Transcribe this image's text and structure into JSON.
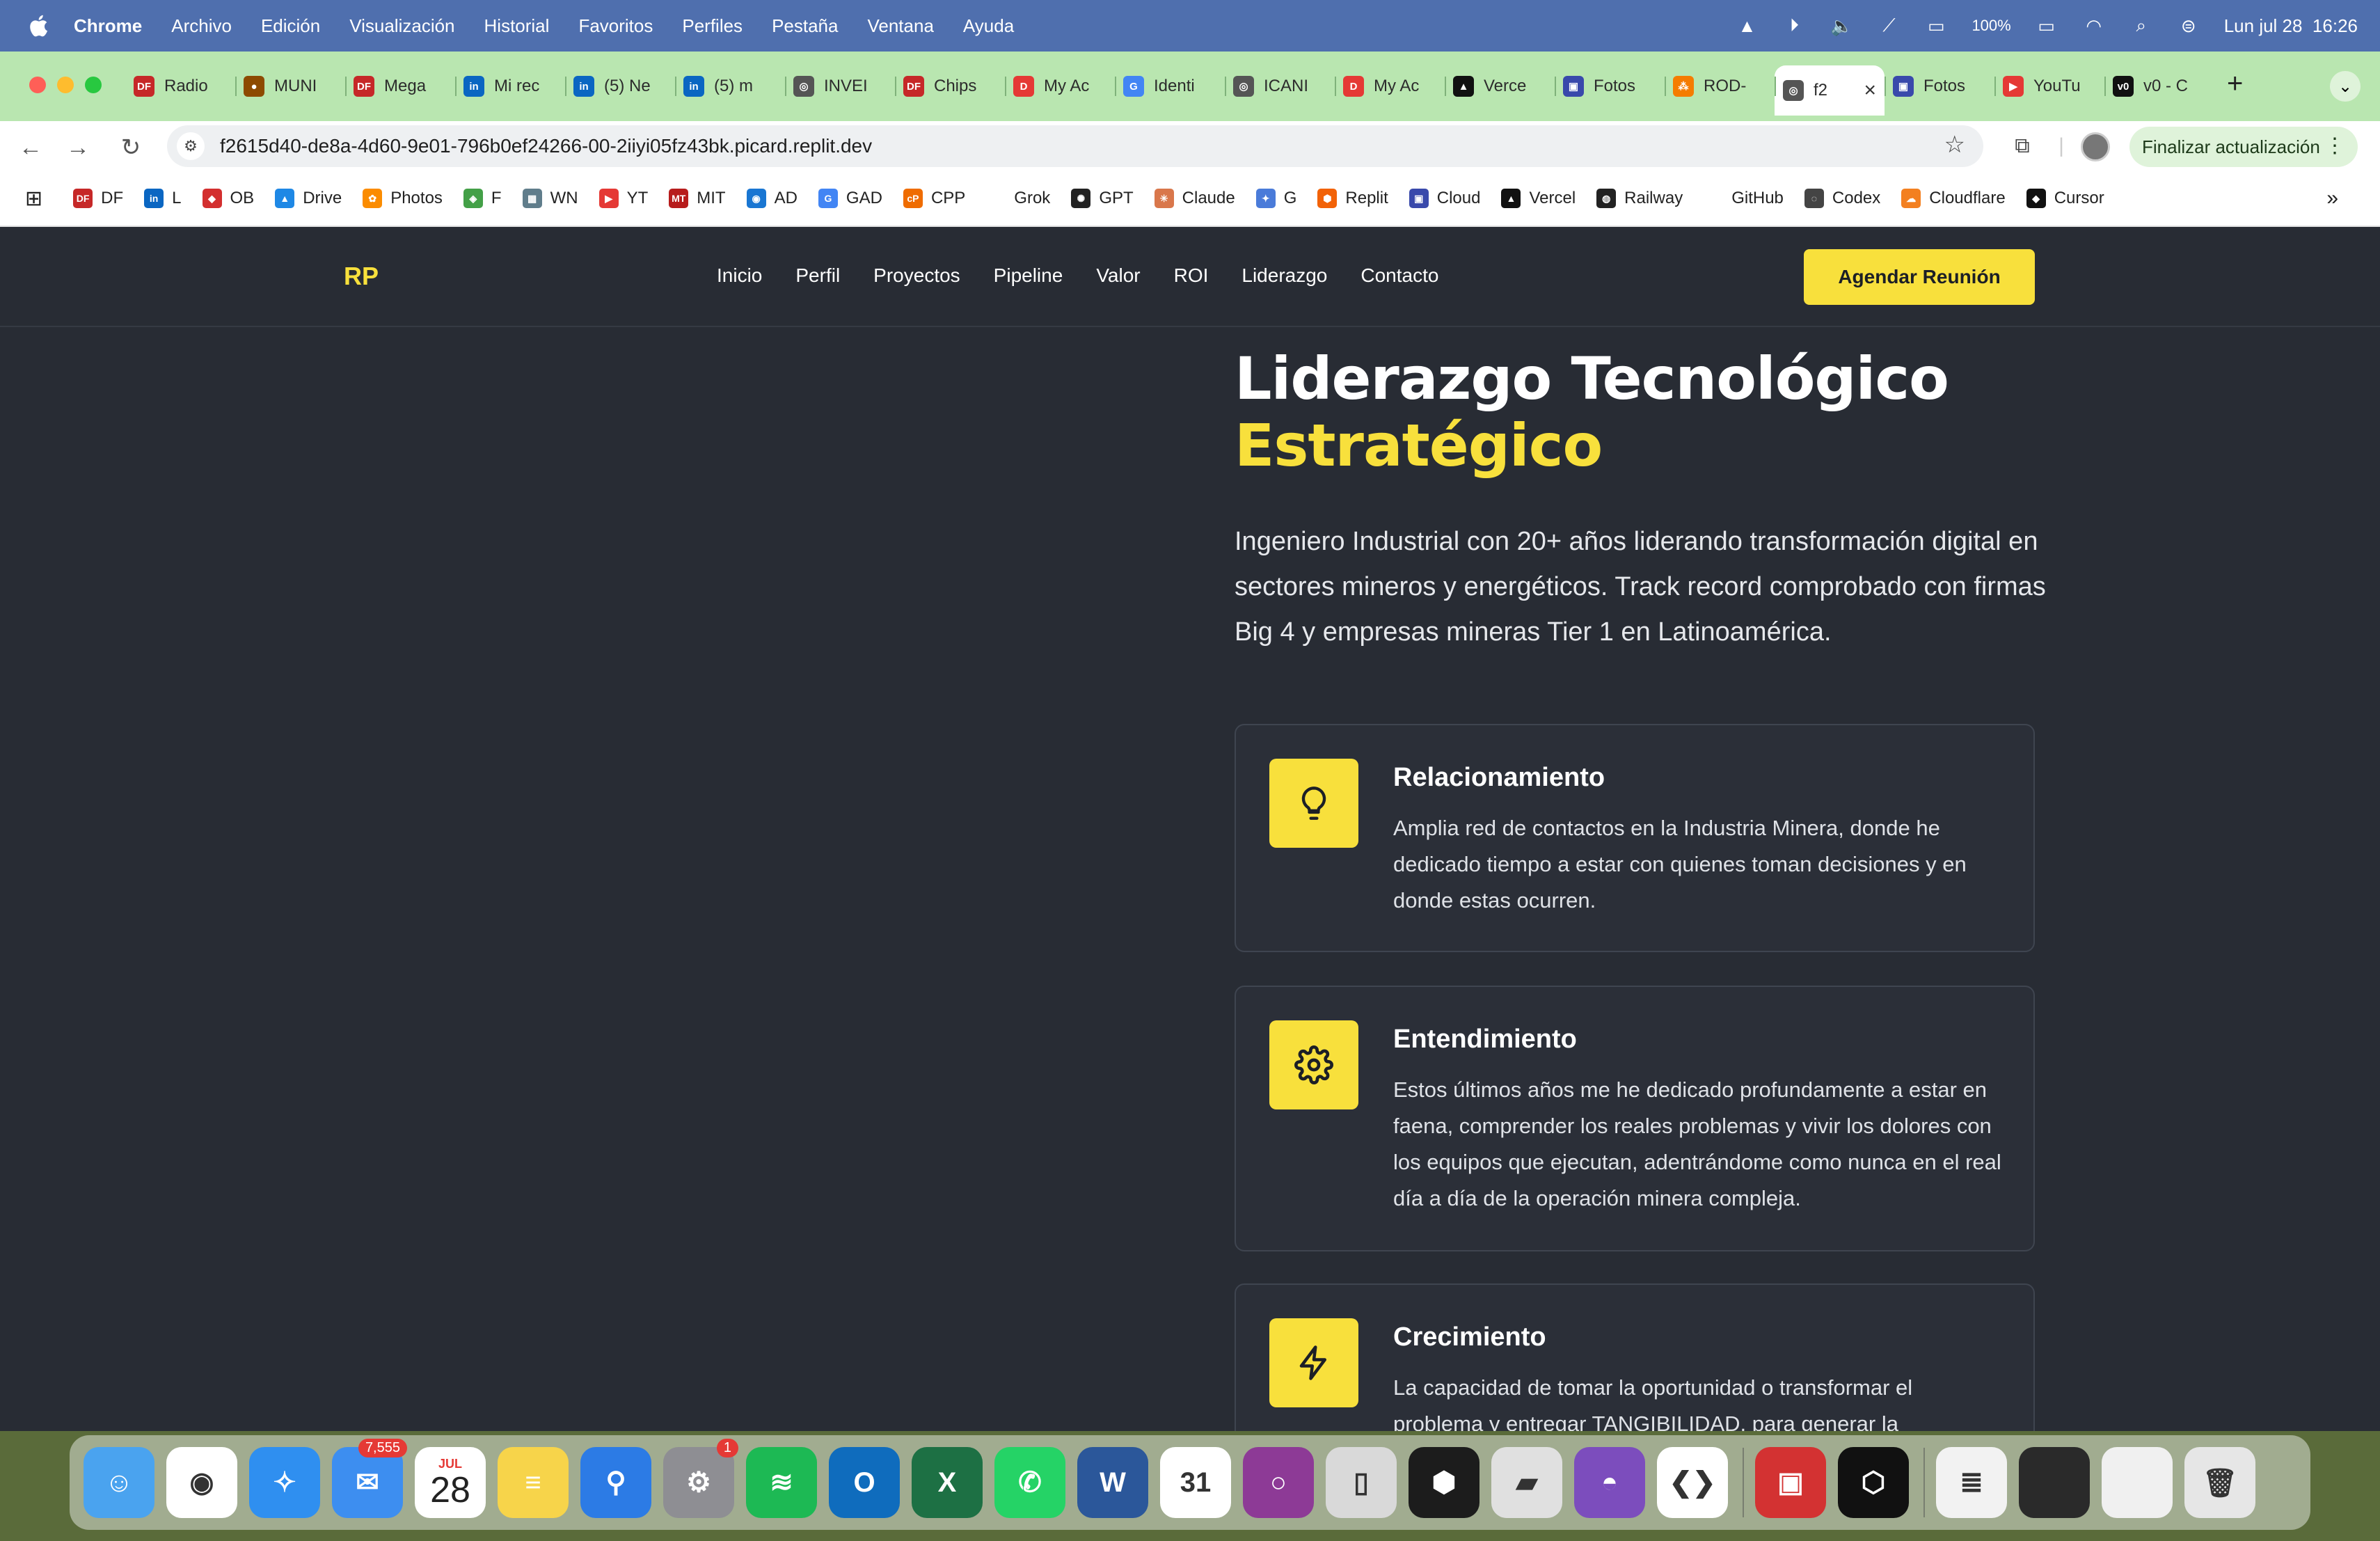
{
  "menubar": {
    "app": "Chrome",
    "items": [
      "Archivo",
      "Edición",
      "Visualización",
      "Historial",
      "Favoritos",
      "Perfiles",
      "Pestaña",
      "Ventana",
      "Ayuda"
    ],
    "battery": "100%",
    "datetime": "Lun jul 28  16:26"
  },
  "tabs": [
    {
      "label": "Radio",
      "icon": "DF",
      "color": "#c62828"
    },
    {
      "label": "MUNI",
      "icon": "●",
      "color": "#8d4a00"
    },
    {
      "label": "Mega",
      "icon": "DF",
      "color": "#c62828"
    },
    {
      "label": "Mi rec",
      "icon": "in",
      "color": "#0a66c2"
    },
    {
      "label": "(5) Ne",
      "icon": "in",
      "color": "#0a66c2"
    },
    {
      "label": "(5) m",
      "icon": "in",
      "color": "#0a66c2"
    },
    {
      "label": "INVEI",
      "icon": "◎",
      "color": "#555"
    },
    {
      "label": "Chips",
      "icon": "DF",
      "color": "#c62828"
    },
    {
      "label": "My Ac",
      "icon": "D",
      "color": "#e53935"
    },
    {
      "label": "Identi",
      "icon": "G",
      "color": "#4285f4"
    },
    {
      "label": "ICANI",
      "icon": "◎",
      "color": "#555"
    },
    {
      "label": "My Ac",
      "icon": "D",
      "color": "#e53935"
    },
    {
      "label": "Verce",
      "icon": "▲",
      "color": "#111"
    },
    {
      "label": "Fotos",
      "icon": "▣",
      "color": "#3949ab"
    },
    {
      "label": "ROD-",
      "icon": "⁂",
      "color": "#f57c00"
    },
    {
      "label": "f2",
      "icon": "◎",
      "color": "#555",
      "active": true
    },
    {
      "label": "Fotos",
      "icon": "▣",
      "color": "#3949ab"
    },
    {
      "label": "YouTu",
      "icon": "▶",
      "color": "#e53935"
    },
    {
      "label": "v0 - C",
      "icon": "v0",
      "color": "#111"
    }
  ],
  "toolbar": {
    "url": "f2615d40-de8a-4d60-9e01-796b0ef24266-00-2iiyi05fz43bk.picard.replit.dev",
    "update_label": "Finalizar actualización"
  },
  "bookmarks": [
    {
      "label": "DF",
      "icon": "DF",
      "color": "#c62828"
    },
    {
      "label": "L",
      "icon": "in",
      "color": "#0a66c2"
    },
    {
      "label": "OB",
      "icon": "◆",
      "color": "#d32f2f"
    },
    {
      "label": "Drive",
      "icon": "▲",
      "color": "#1e88e5"
    },
    {
      "label": "Photos",
      "icon": "✿",
      "color": "#fb8c00"
    },
    {
      "label": "F",
      "icon": "◈",
      "color": "#43a047"
    },
    {
      "label": "WN",
      "icon": "▦",
      "color": "#607d8b"
    },
    {
      "label": "YT",
      "icon": "▶",
      "color": "#e53935"
    },
    {
      "label": "MIT",
      "icon": "MT",
      "color": "#b71c1c"
    },
    {
      "label": "AD",
      "icon": "◉",
      "color": "#1976d2"
    },
    {
      "label": "GAD",
      "icon": "G",
      "color": "#4285f4"
    },
    {
      "label": "CPP",
      "icon": "cP",
      "color": "#ef6c00"
    },
    {
      "label": "Grok",
      "icon": "",
      "color": "#ffffff"
    },
    {
      "label": "GPT",
      "icon": "✺",
      "color": "#222"
    },
    {
      "label": "Claude",
      "icon": "✳",
      "color": "#d9774b"
    },
    {
      "label": "G",
      "icon": "✦",
      "color": "#4a7bd9"
    },
    {
      "label": "Replit",
      "icon": "⬢",
      "color": "#f26207"
    },
    {
      "label": "Cloud",
      "icon": "▣",
      "color": "#3949ab"
    },
    {
      "label": "Vercel",
      "icon": "▲",
      "color": "#111"
    },
    {
      "label": "Railway",
      "icon": "◍",
      "color": "#222"
    },
    {
      "label": "GitHub",
      "icon": "",
      "color": "#ffffff"
    },
    {
      "label": "Codex",
      "icon": "◌",
      "color": "#444"
    },
    {
      "label": "Cloudflare",
      "icon": "☁",
      "color": "#f38020"
    },
    {
      "label": "Cursor",
      "icon": "◆",
      "color": "#111"
    }
  ],
  "site": {
    "logo": "RP",
    "nav": [
      "Inicio",
      "Perfil",
      "Proyectos",
      "Pipeline",
      "Valor",
      "ROI",
      "Liderazgo",
      "Contacto"
    ],
    "cta": "Agendar Reunión",
    "hero_title": "Liderazgo Tecnológico",
    "hero_accent": "Estratégico",
    "hero_desc": "Ingeniero Industrial con 20+ años liderando transformación digital en sectores mineros y energéticos. Track record comprobado con firmas Big 4 y empresas mineras Tier 1 en Latinoamérica.",
    "cards": [
      {
        "title": "Relacionamiento",
        "icon": "lightbulb-icon",
        "desc": "Amplia red de contactos en la Industria Minera, donde he dedicado tiempo a estar con quienes toman decisiones y en donde estas ocurren."
      },
      {
        "title": "Entendimiento",
        "icon": "gear-icon",
        "desc": "Estos últimos años me he dedicado profundamente a estar en faena, comprender los reales problemas y vivir los dolores con los equipos que ejecutan, adentrándome como nunca en el real día a día de la operación minera compleja."
      },
      {
        "title": "Crecimiento",
        "icon": "lightning-icon",
        "desc": "La capacidad de tomar la oportunidad o transformar el problema y entregar TANGIBILIDAD, para generar la"
      }
    ]
  },
  "dock": {
    "mail_badge": "7,555",
    "calendar_month": "JUL",
    "calendar_day": "28",
    "settings_badge": "1",
    "apps": [
      {
        "name": "finder",
        "color": "#4aa3ef",
        "glyph": "☺"
      },
      {
        "name": "chrome",
        "color": "#ffffff",
        "glyph": "◉"
      },
      {
        "name": "safari",
        "color": "#2f8ff0",
        "glyph": "✧"
      },
      {
        "name": "mail",
        "color": "#3d8ef0",
        "glyph": "✉"
      },
      {
        "name": "calendar",
        "color": "#ffffff",
        "glyph": ""
      },
      {
        "name": "notes",
        "color": "#f7d44a",
        "glyph": "≡"
      },
      {
        "name": "keynote",
        "color": "#2c7be5",
        "glyph": "⚲"
      },
      {
        "name": "system-settings",
        "color": "#8e8e93",
        "glyph": "⚙"
      },
      {
        "name": "spotify",
        "color": "#1db954",
        "glyph": "≋"
      },
      {
        "name": "outlook",
        "color": "#0f6cbd",
        "glyph": "O"
      },
      {
        "name": "excel",
        "color": "#1d7044",
        "glyph": "X"
      },
      {
        "name": "whatsapp",
        "color": "#25d366",
        "glyph": "✆"
      },
      {
        "name": "word",
        "color": "#2b579a",
        "glyph": "W"
      },
      {
        "name": "fantastical",
        "color": "#ffffff",
        "glyph": "31"
      },
      {
        "name": "screen-recorder",
        "color": "#8d3a96",
        "glyph": "○"
      },
      {
        "name": "iphone-mirroring",
        "color": "#d9d9d9",
        "glyph": "▯"
      },
      {
        "name": "replit",
        "color": "#1c1c1c",
        "glyph": "⬢"
      },
      {
        "name": "parallels",
        "color": "#e0e0e0",
        "glyph": "▰"
      },
      {
        "name": "github-desktop",
        "color": "#7c4dbd",
        "glyph": "◓"
      },
      {
        "name": "vscode",
        "color": "#ffffff",
        "glyph": "❮❯"
      },
      {
        "name": "photo-booth",
        "color": "#d33232",
        "glyph": "▣"
      },
      {
        "name": "codex",
        "color": "#111111",
        "glyph": "⬡"
      },
      {
        "name": "zip-file",
        "color": "#f2f2f2",
        "glyph": "≣"
      },
      {
        "name": "recent-window-1",
        "color": "#2a2a2a",
        "glyph": ""
      },
      {
        "name": "recent-window-2",
        "color": "#f0f0f0",
        "glyph": ""
      },
      {
        "name": "trash",
        "color": "#e6e6e6",
        "glyph": "🗑"
      }
    ]
  }
}
